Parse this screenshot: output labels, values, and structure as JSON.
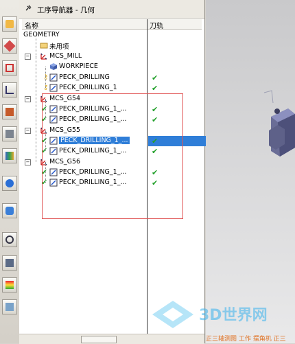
{
  "navigator": {
    "title": "工序导航器 - 几何",
    "columns": {
      "name": "名称",
      "toolpath": "刀轨"
    }
  },
  "tree": [
    {
      "label": "GEOMETRY",
      "status": ""
    },
    {
      "label": "未用项",
      "status": ""
    },
    {
      "label": "MCS_MILL",
      "status": ""
    },
    {
      "label": "WORKPIECE",
      "status": ""
    },
    {
      "label": "PECK_DRILLING",
      "status": "✔"
    },
    {
      "label": "PECK_DRILLING_1",
      "status": "✔"
    },
    {
      "label": "MCS_G54",
      "status": ""
    },
    {
      "label": "PECK_DRILLING_1_...",
      "status": "✔"
    },
    {
      "label": "PECK_DRILLING_1_...",
      "status": "✔"
    },
    {
      "label": "MCS_G55",
      "status": ""
    },
    {
      "label": "PECK_DRILLING_1_...",
      "status": "✔",
      "selected": true
    },
    {
      "label": "PECK_DRILLING_1_...",
      "status": "✔"
    },
    {
      "label": "MCS_G56",
      "status": ""
    },
    {
      "label": "PECK_DRILLING_1_...",
      "status": "✔"
    },
    {
      "label": "PECK_DRILLING_1_...",
      "status": "✔"
    }
  ],
  "status_bar": {
    "text": "正三轴测图  工作 摆角机 正三"
  },
  "watermark": {
    "text": "3D世界网"
  },
  "colors": {
    "selection": "#2f7ed8",
    "check": "#22a02a",
    "highlight_box": "#e05353"
  },
  "icons": [
    "settings-icon",
    "assembly-icon",
    "part-navigator-icon",
    "operation-navigator-icon",
    "roles-icon",
    "history-icon",
    "reuse-library-icon",
    "web-browser-icon",
    "palette-icon",
    "clock-icon",
    "report-icon",
    "analysis-icon"
  ]
}
